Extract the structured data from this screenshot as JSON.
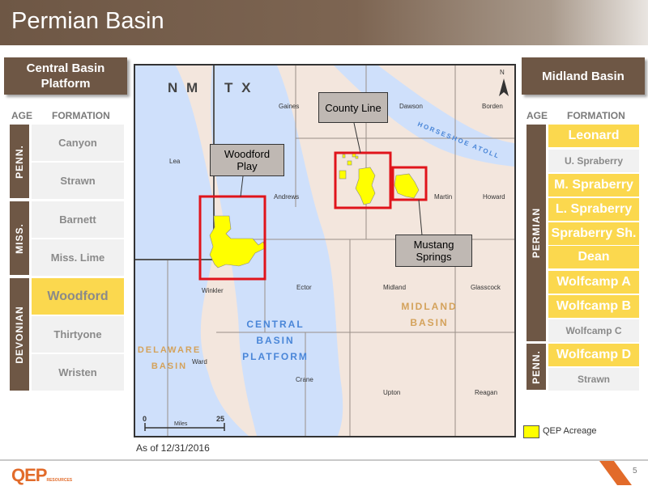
{
  "title": "Permian Basin",
  "left_panel": {
    "header": "Central Basin Platform",
    "age_label": "AGE",
    "formation_label": "FORMATION",
    "groups": [
      {
        "age": "PENN.",
        "formations": [
          "Canyon",
          "Strawn"
        ]
      },
      {
        "age": "MISS.",
        "formations": [
          "Barnett",
          "Miss. Lime"
        ]
      },
      {
        "age": "DEVONIAN",
        "formations": [
          "Woodford",
          "Thirtyone",
          "Wristen"
        ]
      }
    ],
    "highlighted": [
      "Woodford"
    ]
  },
  "right_panel": {
    "header": "Midland Basin",
    "age_label": "AGE",
    "formation_label": "FORMATION",
    "groups": [
      {
        "age": "PERMIAN",
        "formations": [
          "Leonard",
          "U. Spraberry",
          "M. Spraberry",
          "L. Spraberry",
          "Spraberry Sh.",
          "Dean",
          "Wolfcamp A",
          "Wolfcamp B",
          "Wolfcamp C"
        ]
      },
      {
        "age": "PENN.",
        "formations": [
          "Wolfcamp D",
          "Strawn"
        ]
      }
    ],
    "highlighted": [
      "Leonard",
      "M. Spraberry",
      "L. Spraberry",
      "Spraberry Sh.",
      "Dean",
      "Wolfcamp A",
      "Wolfcamp B",
      "Wolfcamp D"
    ]
  },
  "map": {
    "state_nm": "N M",
    "state_tx": "T X",
    "north": "N",
    "callouts": {
      "county_line": "County Line",
      "woodford_play": "Woodford Play",
      "mustang_springs": "Mustang Springs"
    },
    "counties": [
      "Gaines",
      "Dawson",
      "Borden",
      "Lea",
      "Andrews",
      "Martin",
      "Howard",
      "Winkler",
      "Ector",
      "Midland",
      "Glasscock",
      "Ward",
      "Crane",
      "Upton",
      "Reagan"
    ],
    "regions": {
      "horseshoe_atoll": "HORSESHOE ATOLL",
      "central_basin_platform": [
        "CENTRAL",
        "BASIN",
        "PLATFORM"
      ],
      "midland_basin": [
        "MIDLAND",
        "BASIN"
      ],
      "delaware_basin": [
        "DELAWARE",
        "BASIN"
      ]
    },
    "scale": {
      "start": "0",
      "end": "25",
      "unit": "Miles"
    }
  },
  "legend": {
    "label": "QEP Acreage",
    "color": "#ffff00"
  },
  "as_of": "As of 12/31/2016",
  "logo": {
    "text": "QEP",
    "sub": "RESOURCES"
  },
  "page_number": "5",
  "colors": {
    "brand_brown": "#6e5745",
    "highlight_yellow": "#fbd84e",
    "callout_red": "#e0141b",
    "basin_blue": "#cfe0fb",
    "land_tan": "#f3e6dd"
  }
}
